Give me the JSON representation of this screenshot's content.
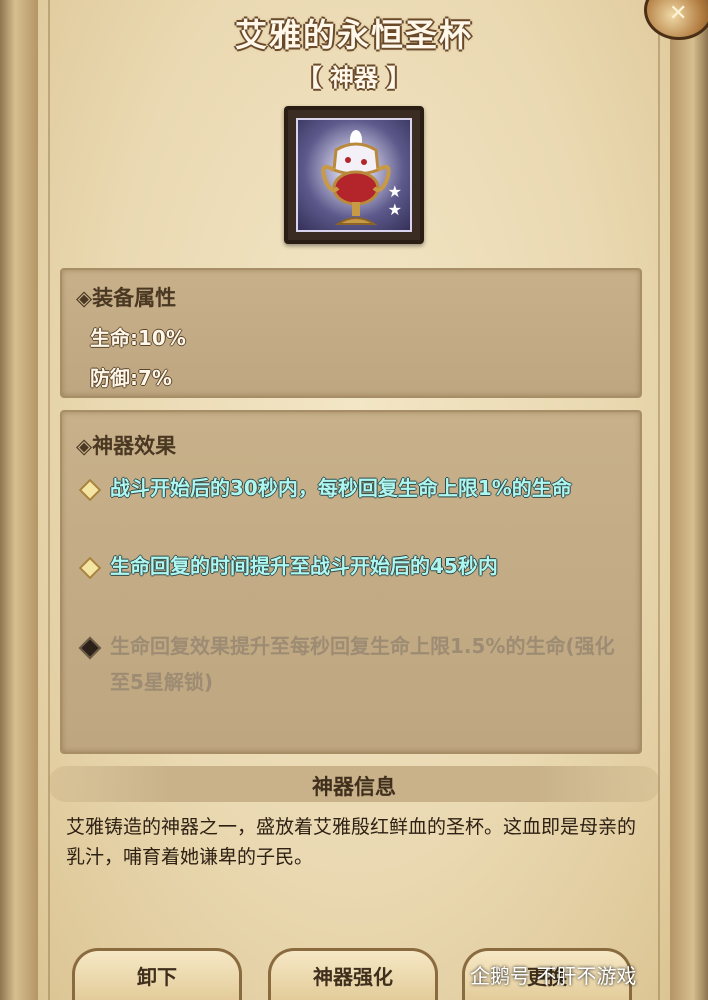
{
  "header": {
    "title": "艾雅的永恒圣杯",
    "subtitle": "【 神器 】"
  },
  "stats_panel": {
    "header": "◈装备属性",
    "stats": [
      "生命:10%",
      "防御:7%"
    ]
  },
  "effects_panel": {
    "header": "◈神器效果",
    "effects": [
      {
        "text": "战斗开始后的30秒内，每秒回复生命上限1%的生命",
        "unlocked": true
      },
      {
        "text": "生命回复的时间提升至战斗开始后的45秒内",
        "unlocked": true
      },
      {
        "text": "生命回复效果提升至每秒回复生命上限1.5%的生命(强化至5星解锁)",
        "unlocked": false
      }
    ]
  },
  "info": {
    "title": "神器信息",
    "description": "艾雅铸造的神器之一，盛放着艾雅殷红鲜血的圣杯。这血即是母亲的乳汁，哺育着她谦卑的子民。"
  },
  "buttons": {
    "unequip": "卸下",
    "enhance": "神器强化",
    "replace": "更换"
  },
  "watermark": "企鹅号 不肝不游戏",
  "item": {
    "stars": 2,
    "icon": "holy-grail-icon"
  }
}
